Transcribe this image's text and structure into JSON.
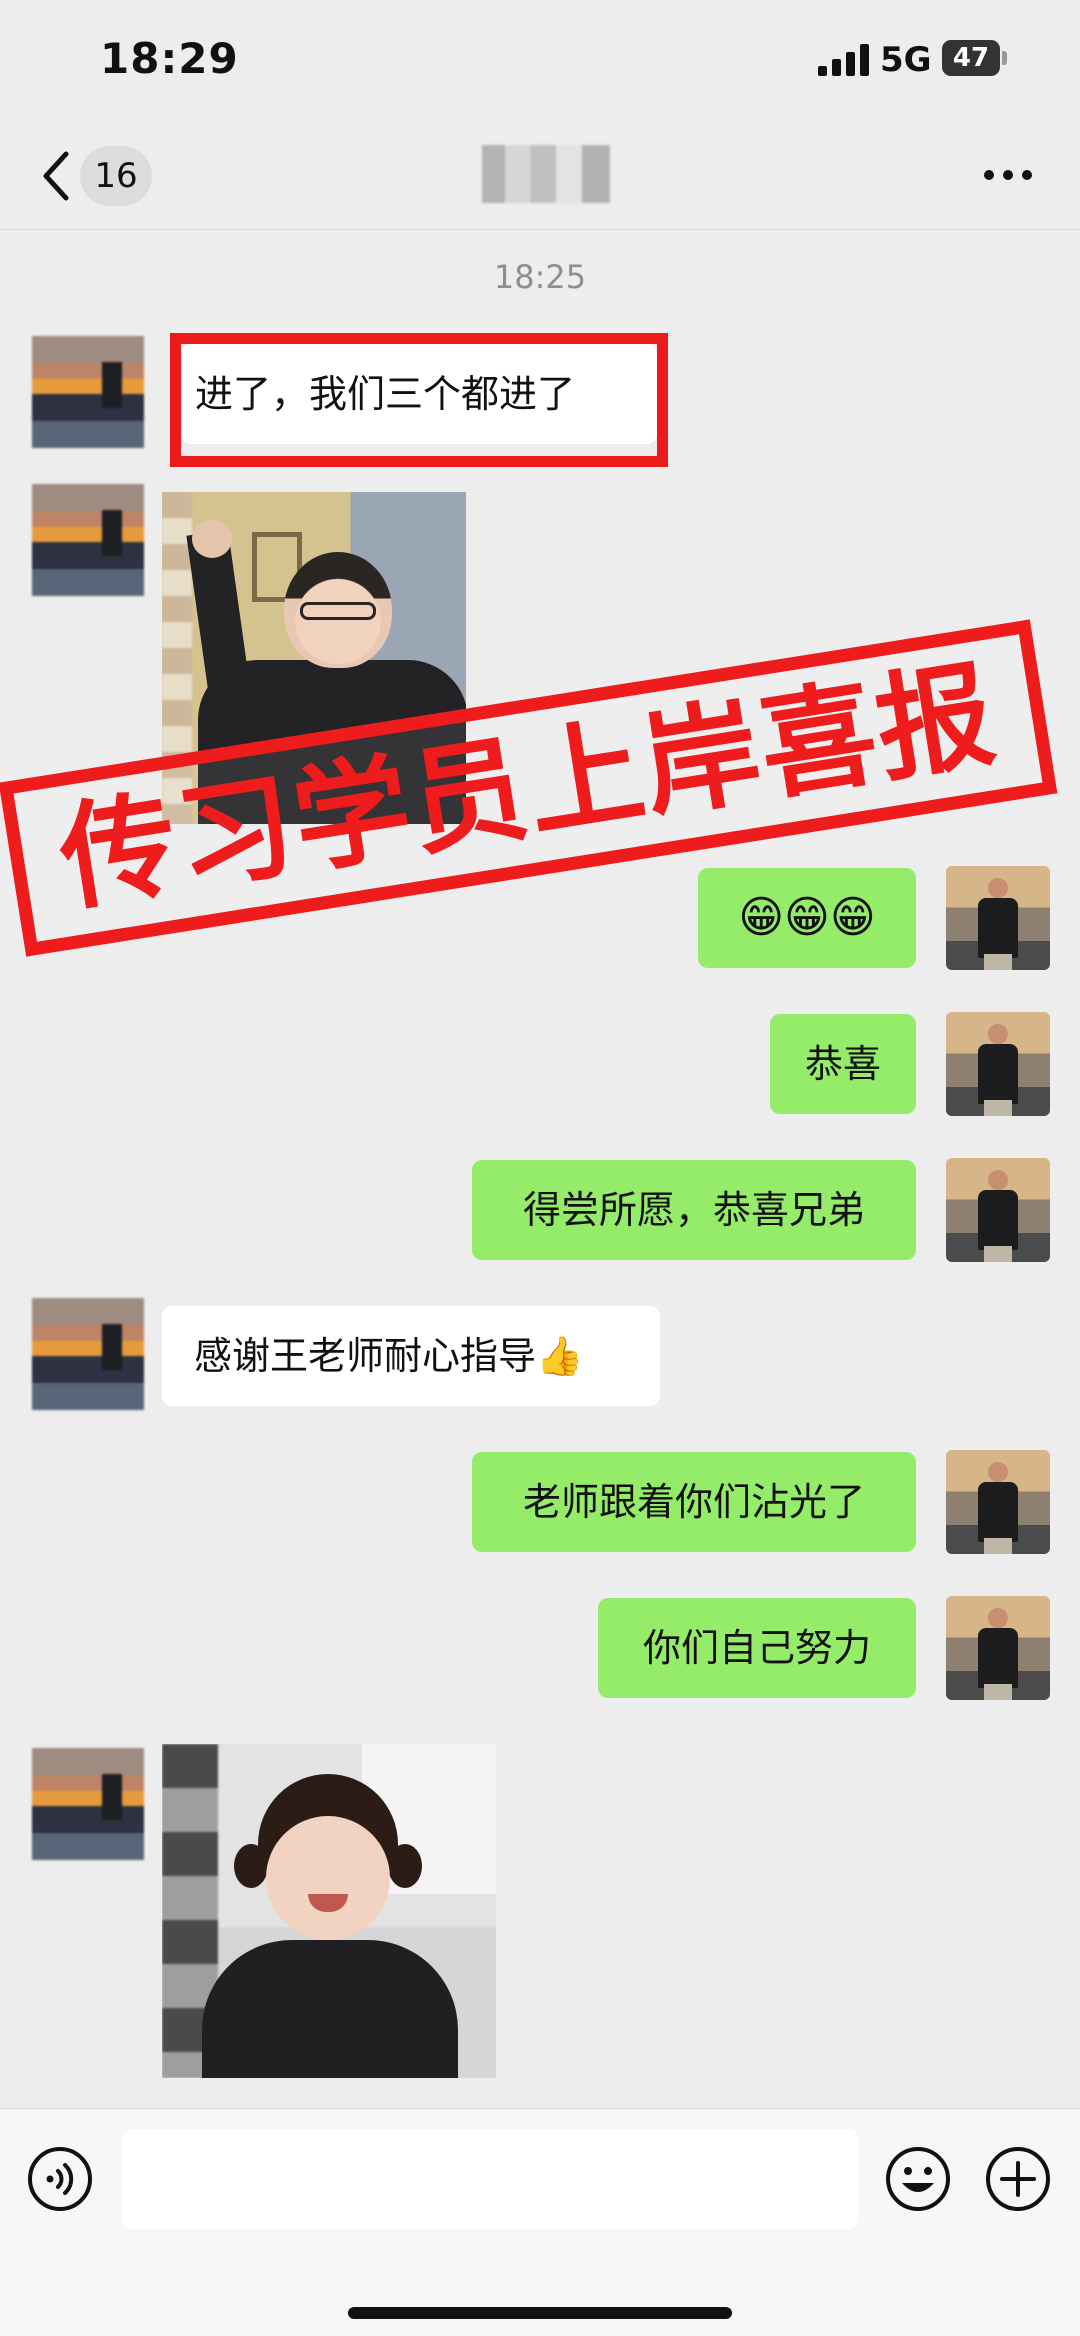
{
  "status_bar": {
    "time": "18:29",
    "network": "5G",
    "battery": "47"
  },
  "nav": {
    "unread_count": "16"
  },
  "chat": {
    "timestamp": "18:25",
    "messages": [
      {
        "from": "contact",
        "type": "text",
        "text": "进了，我们三个都进了",
        "highlighted": true
      },
      {
        "from": "contact",
        "type": "image"
      },
      {
        "from": "me",
        "type": "text",
        "text": "😁😁😁"
      },
      {
        "from": "me",
        "type": "text",
        "text": "恭喜"
      },
      {
        "from": "me",
        "type": "text",
        "text": "得尝所愿，恭喜兄弟"
      },
      {
        "from": "contact",
        "type": "text",
        "text": "感谢王老师耐心指导",
        "emoji": "👍"
      },
      {
        "from": "me",
        "type": "text",
        "text": "老师跟着你们沾光了"
      },
      {
        "from": "me",
        "type": "text",
        "text": "你们自己努力"
      },
      {
        "from": "contact",
        "type": "image"
      }
    ]
  },
  "overlay": {
    "stamp_text": "传习学员上岸喜报",
    "color": "#ee1c1c"
  },
  "colors": {
    "background": "#ededed",
    "outgoing_bubble": "#95ec69",
    "incoming_bubble": "#ffffff"
  },
  "input_bar": {
    "message_value": ""
  }
}
